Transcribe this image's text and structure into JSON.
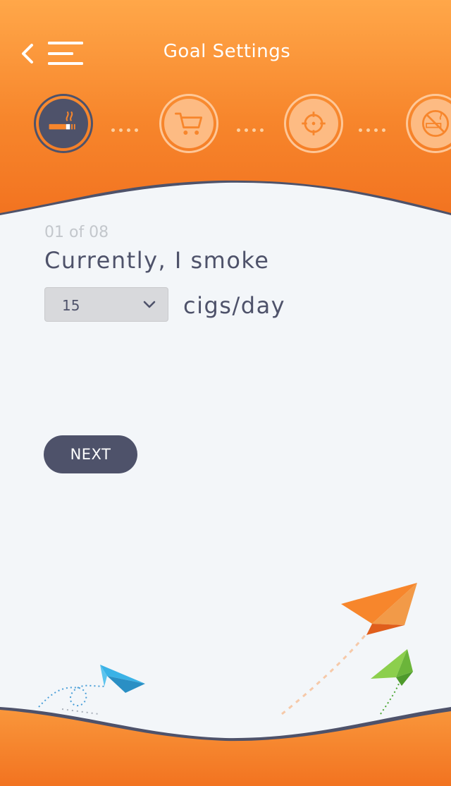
{
  "header": {
    "title": "Goal Settings",
    "colors": {
      "top": "#ffa749",
      "bottom": "#f27320",
      "accent_dark": "#4e526a"
    }
  },
  "steps": [
    {
      "icon": "cigarette-icon",
      "state": "active"
    },
    {
      "icon": "cart-icon",
      "state": "pending"
    },
    {
      "icon": "target-icon",
      "state": "pending"
    },
    {
      "icon": "no-smoking-icon",
      "state": "pending"
    }
  ],
  "content": {
    "counter": "01 of 08",
    "question": "Currently, I smoke",
    "select_value": "15",
    "unit": "cigs/day",
    "next_label": "NEXT"
  }
}
